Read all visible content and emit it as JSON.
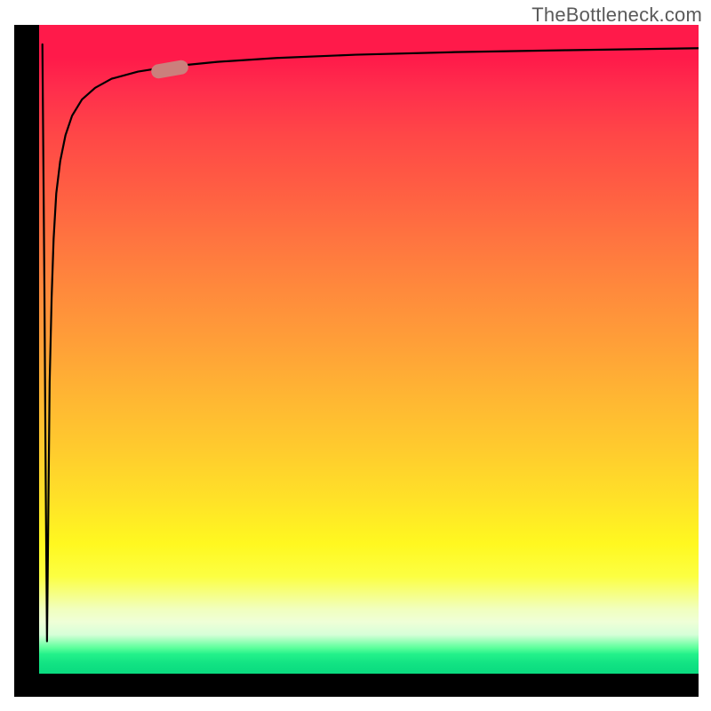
{
  "watermark": {
    "text": "TheBottleneck.com"
  },
  "chart_data": {
    "type": "line",
    "title": "",
    "xlabel": "",
    "ylabel": "",
    "x_range": [
      0,
      100
    ],
    "y_range": [
      0,
      100
    ],
    "background_gradient": {
      "top": "#ff1a4a",
      "upper_mid": "#ffa000",
      "lower_mid": "#ffff20",
      "bottom": "#0adb7f"
    },
    "series": [
      {
        "name": "bottleneck-curve",
        "type": "line",
        "x": [
          0.5,
          0.8,
          1.0,
          1.2,
          1.4,
          1.6,
          1.9,
          2.2,
          2.6,
          3.2,
          4.0,
          5.0,
          6.5,
          8.5,
          11,
          15,
          20,
          27,
          36,
          48,
          63,
          80,
          100
        ],
        "y": [
          97,
          60,
          30,
          5,
          25,
          45,
          58,
          67,
          74,
          79,
          83,
          86,
          88.5,
          90.3,
          91.7,
          92.8,
          93.6,
          94.3,
          94.9,
          95.4,
          95.8,
          96.1,
          96.4
        ]
      }
    ],
    "marker": {
      "x": 20,
      "y": 93.3,
      "shape": "pill",
      "color": "#cb7f7c"
    }
  }
}
